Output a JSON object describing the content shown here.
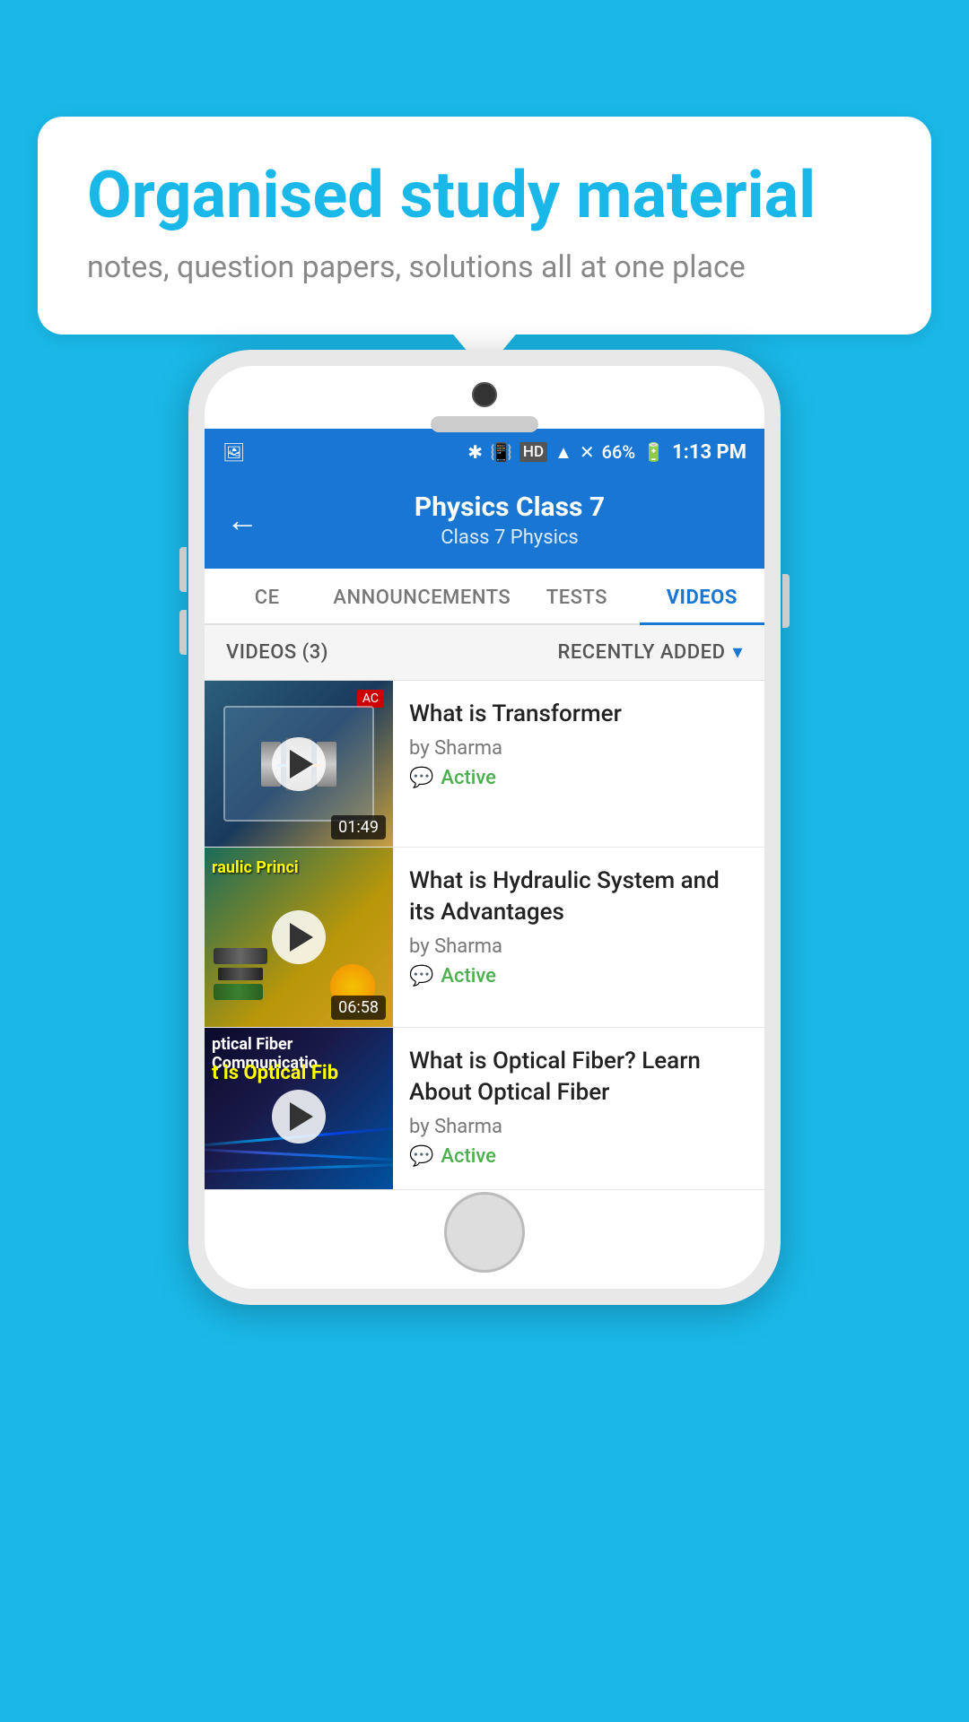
{
  "bubble": {
    "title": "Organised study material",
    "subtitle": "notes, question papers, solutions all at one place"
  },
  "statusBar": {
    "battery": "66%",
    "time": "1:13 PM"
  },
  "header": {
    "title": "Physics Class 7",
    "subtitle": "Class 7   Physics",
    "backLabel": "←"
  },
  "tabs": [
    {
      "label": "CE",
      "active": false
    },
    {
      "label": "ANNOUNCEMENTS",
      "active": false
    },
    {
      "label": "TESTS",
      "active": false
    },
    {
      "label": "VIDEOS",
      "active": true
    }
  ],
  "filterBar": {
    "count": "VIDEOS (3)",
    "sort": "RECENTLY ADDED"
  },
  "videos": [
    {
      "title": "What is  Transformer",
      "author": "by Sharma",
      "status": "Active",
      "duration": "01:49",
      "thumbType": "transformer"
    },
    {
      "title": "What is Hydraulic System and its Advantages",
      "author": "by Sharma",
      "status": "Active",
      "duration": "06:58",
      "thumbType": "hydraulic"
    },
    {
      "title": "What is Optical Fiber? Learn About Optical Fiber",
      "author": "by Sharma",
      "status": "Active",
      "duration": "",
      "thumbType": "optical"
    }
  ],
  "icons": {
    "back": "←",
    "play": "▶",
    "chat": "💬",
    "chevronDown": "▾"
  }
}
